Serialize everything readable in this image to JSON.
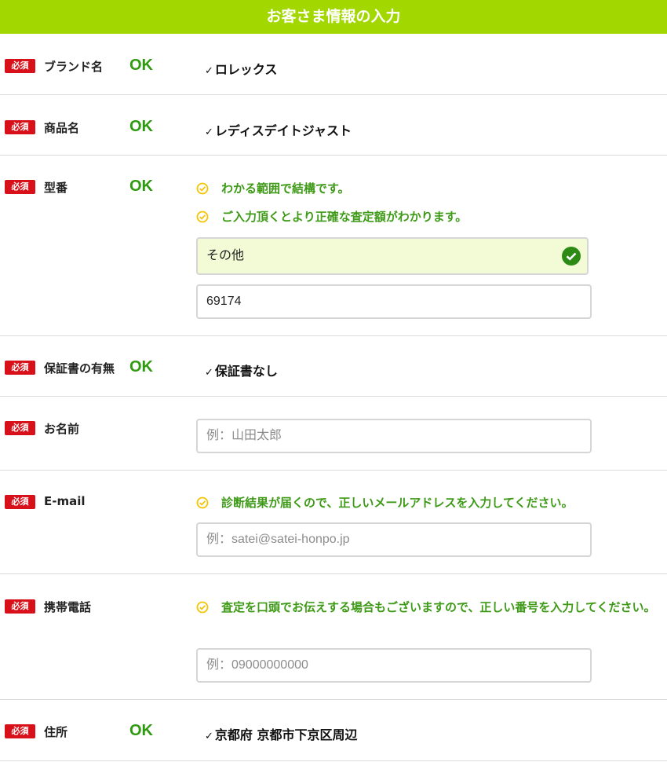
{
  "header": {
    "title": "お客さま情報の入力"
  },
  "required_label": "必須",
  "ok_label": "OK",
  "tick": "✓",
  "rows": {
    "brand": {
      "label": "ブランド名",
      "value": "ロレックス"
    },
    "product": {
      "label": "商品名",
      "value": "レディスデイトジャスト"
    },
    "model": {
      "label": "型番",
      "notes": [
        "わかる範囲で結構です。",
        "ご入力頂くとより正確な査定額がわかります。"
      ],
      "select_value": "その他",
      "input_value": "69174"
    },
    "warranty": {
      "label": "保証書の有無",
      "value": "保証書なし"
    },
    "name": {
      "label": "お名前",
      "placeholder": "例：山田太郎"
    },
    "email": {
      "label": "E-mail",
      "note": "診断結果が届くので、正しいメールアドレスを入力してください。",
      "placeholder": "例：satei@satei-honpo.jp"
    },
    "phone": {
      "label": "携帯電話",
      "note": "査定を口頭でお伝えする場合もございますので、正しい番号を入力してください。",
      "placeholder": "例：09000000000"
    },
    "address": {
      "label": "住所",
      "value": "京都府 京都市下京区周辺"
    }
  },
  "colors": {
    "header": "#a2d800",
    "badge": "#d8101a",
    "ok": "#2d9a0f",
    "note": "#3e9a17",
    "note_icon": "#f5c400"
  }
}
